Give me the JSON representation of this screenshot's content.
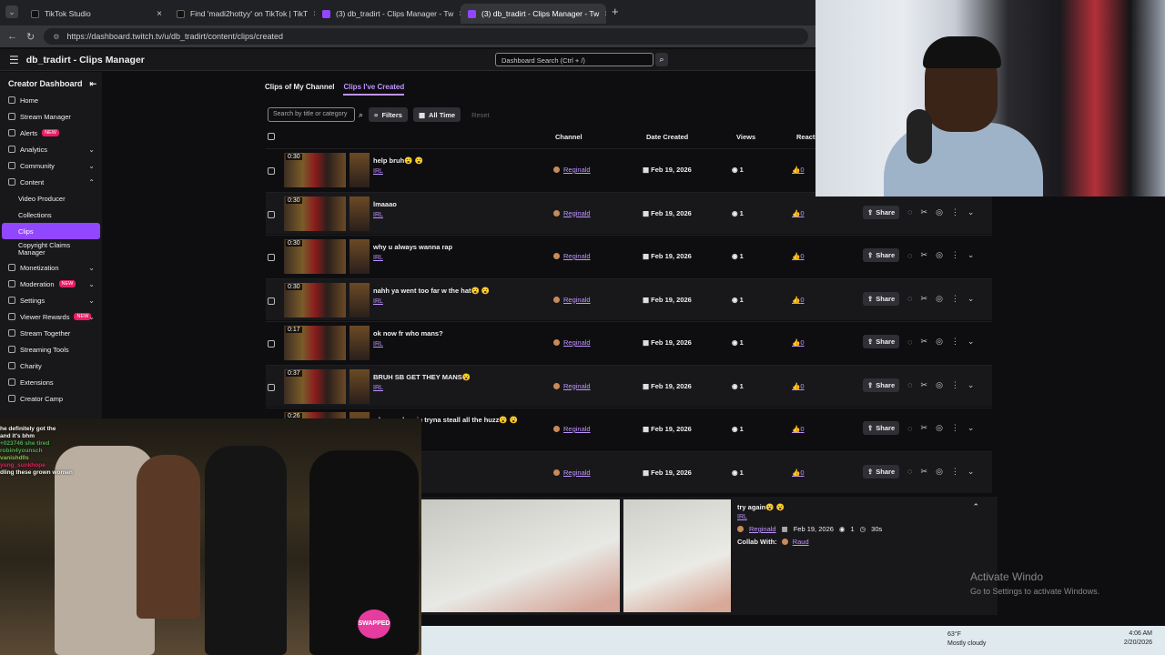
{
  "browser": {
    "tabs": [
      {
        "label": "TikTok Studio",
        "active": false
      },
      {
        "label": "Find 'madi2hottyy' on TikTok | TikT",
        "active": false
      },
      {
        "label": "(3) db_tradirt - Clips Manager - Tw",
        "active": false
      },
      {
        "label": "(3) db_tradirt - Clips Manager - Tw",
        "active": true
      }
    ],
    "url": "https://dashboard.twitch.tv/u/db_tradirt/content/clips/created"
  },
  "topbar": {
    "title": "db_tradirt - Clips Manager",
    "search_placeholder": "Dashboard Search (Ctrl + /)"
  },
  "sidebar": {
    "header": "Creator Dashboard",
    "items": [
      {
        "label": "Home"
      },
      {
        "label": "Stream Manager"
      },
      {
        "label": "Alerts",
        "badge": "NEW"
      },
      {
        "label": "Analytics",
        "chevron": "⌄"
      },
      {
        "label": "Community",
        "chevron": "⌄"
      },
      {
        "label": "Content",
        "chevron": "⌃"
      },
      {
        "label": "Video Producer",
        "sub": true
      },
      {
        "label": "Collections",
        "sub": true
      },
      {
        "label": "Clips",
        "sub": true,
        "active": true
      },
      {
        "label": "Copyright Claims Manager",
        "sub": true
      },
      {
        "label": "Monetization",
        "chevron": "⌄"
      },
      {
        "label": "Moderation",
        "badge": "NEW",
        "chevron": "⌄"
      },
      {
        "label": "Settings",
        "chevron": "⌄"
      },
      {
        "label": "Viewer Rewards",
        "badge": "NEW",
        "chevron": "⌄"
      },
      {
        "label": "Stream Together"
      },
      {
        "label": "Streaming Tools"
      },
      {
        "label": "Charity"
      },
      {
        "label": "Extensions"
      },
      {
        "label": "Creator Camp"
      }
    ]
  },
  "main": {
    "tabs": {
      "mine": "Clips of My Channel",
      "created": "Clips I've Created"
    },
    "search_placeholder": "Search by title or category",
    "filters_label": "Filters",
    "time_label": "All Time",
    "reset_label": "Reset",
    "columns": {
      "channel": "Channel",
      "date": "Date Created",
      "views": "Views",
      "reactions": "Reacti"
    },
    "share_label": "Share",
    "rows": [
      {
        "duration": "0:30",
        "title": "help bruh😮 😮",
        "category": "IRL",
        "channel": "Reginald",
        "date": "Feb 19, 2026",
        "views": "1",
        "reactions": "0"
      },
      {
        "duration": "0:30",
        "title": "lmaaao",
        "category": "IRL",
        "channel": "Reginald",
        "date": "Feb 19, 2026",
        "views": "1",
        "reactions": "0"
      },
      {
        "duration": "0:30",
        "title": "why u always wanna rap",
        "category": "IRL",
        "channel": "Reginald",
        "date": "Feb 19, 2026",
        "views": "1",
        "reactions": "0"
      },
      {
        "duration": "0:30",
        "title": "nahh ya went too far w the hat😮 😮",
        "category": "IRL",
        "channel": "Reginald",
        "date": "Feb 19, 2026",
        "views": "1",
        "reactions": "0"
      },
      {
        "duration": "0:17",
        "title": "ok now fr who mans?",
        "category": "IRL",
        "channel": "Reginald",
        "date": "Feb 19, 2026",
        "views": "1",
        "reactions": "0"
      },
      {
        "duration": "0:37",
        "title": "BRUH SB GET THEY MANS😮",
        "category": "IRL",
        "channel": "Reginald",
        "date": "Feb 19, 2026",
        "views": "1",
        "reactions": "0"
      },
      {
        "duration": "0:26",
        "title": "when yo homie tryna steall all the huzz😮 😮",
        "category": "",
        "channel": "Reginald",
        "date": "Feb 19, 2026",
        "views": "1",
        "reactions": "0"
      },
      {
        "duration": "",
        "title": "",
        "category": "",
        "channel": "Reginald",
        "date": "Feb 19, 2026",
        "views": "1",
        "reactions": "0"
      }
    ]
  },
  "detail": {
    "title": "try again😮 😮",
    "category": "IRL",
    "channel": "Reginald",
    "date": "Feb 19, 2026",
    "views": "1",
    "duration": "30s",
    "collab_label": "Collab With:",
    "collab_name": "Raud"
  },
  "overlay_chat": [
    {
      "user": "",
      "text": "he definitely got the"
    },
    {
      "user": "",
      "text": "and it's bhm"
    },
    {
      "user": "",
      "text": "+023746  she tired"
    },
    {
      "user": "",
      "text": "robin4younsch"
    },
    {
      "user": "",
      "text": "vanishd0s"
    },
    {
      "user": "",
      "text": "yung_sunkhope"
    },
    {
      "user": "",
      "text": "dling these grown women"
    }
  ],
  "overlay_badge": "SWAPPED",
  "windows": {
    "activate_title": "Activate Windo",
    "activate_sub": "Go to Settings to activate Windows.",
    "weather_temp": "63°F",
    "weather_desc": "Mostly cloudy",
    "time": "4:06 AM",
    "date": "2/20/2026"
  }
}
